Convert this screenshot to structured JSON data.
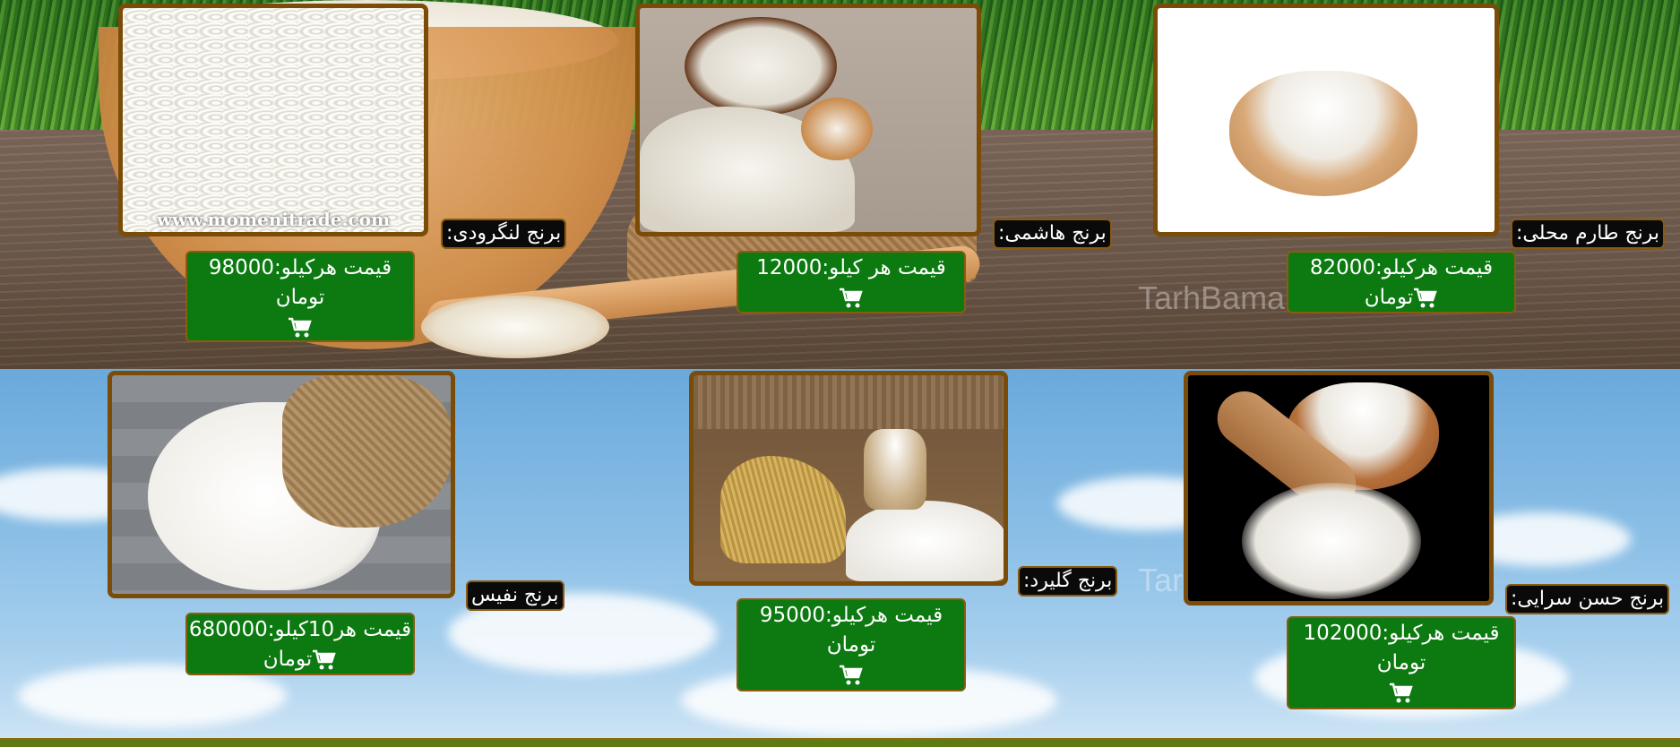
{
  "background": {
    "watermark_top": "TarhBama.com",
    "watermark_bottom": "TarhBama.com"
  },
  "colors": {
    "card_border": "#7a4c08",
    "price_bg": "#0c7a10",
    "name_bg": "#0a0a0a",
    "footer": "#5f7a14"
  },
  "products": [
    {
      "name": "برنج لنگرودی:",
      "price_line1": "قیمت هرکیلو:98000",
      "price_line2": "تومان",
      "image_caption": "www.momenitrade.com",
      "icon": "shopping-cart-icon"
    },
    {
      "name": "برنج هاشمی:",
      "price_line1": "قیمت هر کیلو:12000",
      "price_line2": "",
      "icon": "shopping-cart-icon"
    },
    {
      "name": "برنج طارم محلی:",
      "price_line1": "قیمت هرکیلو:82000",
      "price_line2": "تومان",
      "icon": "shopping-cart-icon"
    },
    {
      "name": "برنج نفیس",
      "price_line1": "قیمت هر10کیلو:680000",
      "price_line2": "تومان",
      "icon": "shopping-cart-icon"
    },
    {
      "name": "برنج گلیرد:",
      "price_line1": "قیمت هرکیلو:95000",
      "price_line2": "تومان",
      "icon": "shopping-cart-icon"
    },
    {
      "name": "برنج حسن سرایی:",
      "price_line1": "قیمت هرکیلو:102000",
      "price_line2": "تومان",
      "icon": "shopping-cart-icon"
    }
  ]
}
